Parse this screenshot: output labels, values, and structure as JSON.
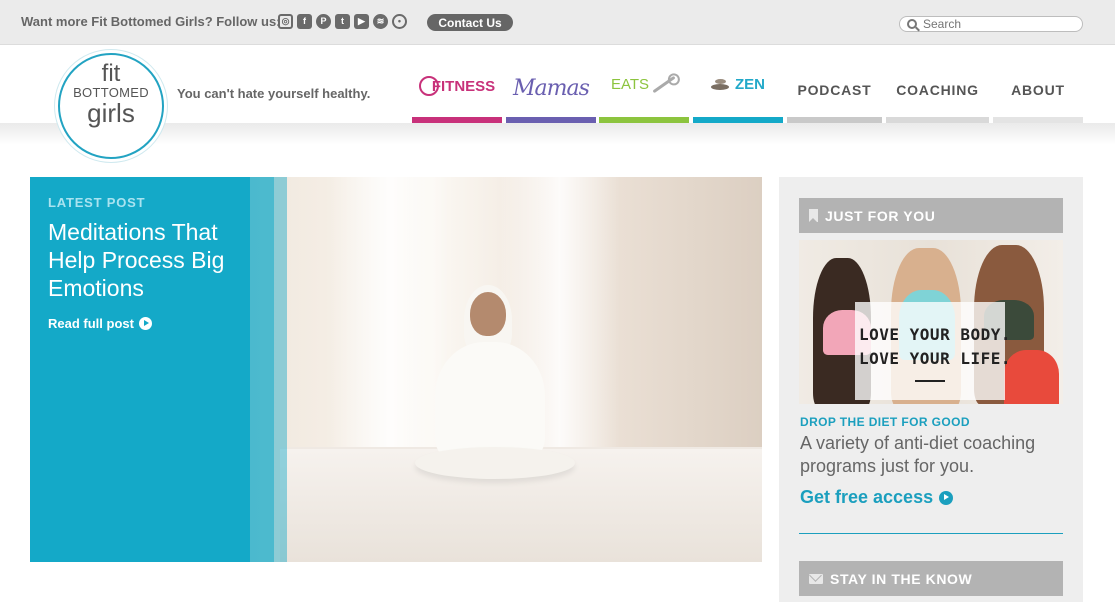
{
  "topbar": {
    "follow_text": "Want more Fit Bottomed Girls? Follow us:",
    "social_icons": [
      "instagram-icon",
      "facebook-icon",
      "pinterest-icon",
      "twitter-icon",
      "youtube-icon",
      "spotify-icon",
      "podcast-icon"
    ],
    "contact_label": "Contact Us",
    "search_placeholder": "Search"
  },
  "header": {
    "logo": {
      "line1": "fit",
      "line2": "BOTTOMED",
      "line3": "girls"
    },
    "tagline": "You can't hate yourself healthy.",
    "nav": [
      {
        "label": "FITNESS",
        "accent": "#c8317a"
      },
      {
        "label": "Mamas",
        "accent": "#6a5fb0"
      },
      {
        "label": "EATS",
        "accent": "#8cc43e"
      },
      {
        "label": "ZEN",
        "accent": "#14a9c8"
      },
      {
        "label": "PODCAST",
        "accent": "#c9c9c9"
      },
      {
        "label": "COACHING",
        "accent": "#d9d9d9"
      },
      {
        "label": "ABOUT",
        "accent": "#e4e4e4"
      }
    ]
  },
  "hero": {
    "kicker": "LATEST POST",
    "title": "Meditations That Help Process Big Emotions",
    "cta": "Read full post",
    "accent": "#14a9c8"
  },
  "sidebar": {
    "just_for_you": "JUST FOR YOU",
    "promo_line1": "LOVE YOUR BODY.",
    "promo_line2": "LOVE YOUR LIFE.",
    "kicker": "DROP THE DIET FOR GOOD",
    "description": "A variety of anti-diet coaching programs just for you.",
    "cta": "Get free access",
    "stay_label": "STAY IN THE KNOW",
    "accent": "#1b9fbe"
  }
}
